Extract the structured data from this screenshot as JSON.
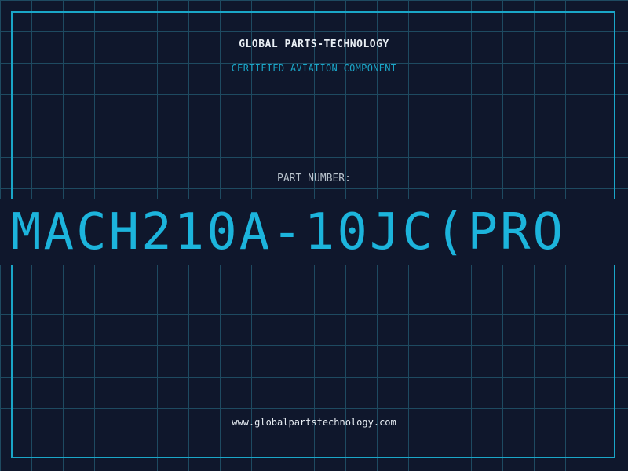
{
  "header": {
    "company": "GLOBAL PARTS-TECHNOLOGY",
    "subtitle": "CERTIFIED AVIATION COMPONENT"
  },
  "part": {
    "label": "PART NUMBER:",
    "number": "MACH210A-10JC(PRO"
  },
  "footer": {
    "website": "www.globalpartstechnology.com"
  },
  "colors": {
    "background": "#0f172c",
    "grid": "#1e4a61",
    "accent": "#1cb4dc",
    "frame": "#1aa6c8",
    "text": "#e8eef4",
    "muted": "#b8c2cc"
  }
}
